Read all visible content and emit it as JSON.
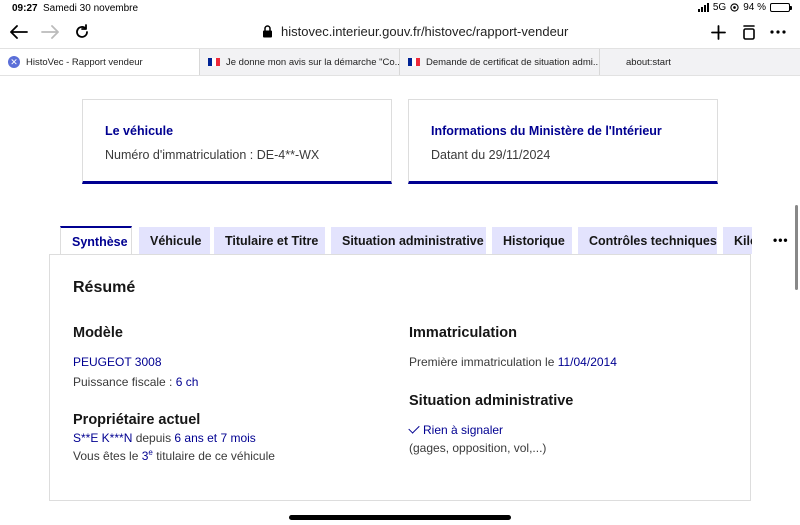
{
  "status": {
    "time": "09:27",
    "date": "Samedi 30 novembre",
    "network": "5G",
    "battery": "94 %"
  },
  "browser": {
    "url": "histovec.interieur.gouv.fr/histovec/rapport-vendeur",
    "tabs": [
      {
        "label": "HistoVec - Rapport vendeur"
      },
      {
        "label": "Je donne mon avis sur la démarche \"Co..."
      },
      {
        "label": "Demande de certificat de situation admi..."
      },
      {
        "label": "about:start"
      }
    ]
  },
  "cards": {
    "vehicule": {
      "title": "Le véhicule",
      "text": "Numéro d'immatriculation : DE-4**-WX"
    },
    "ministere": {
      "title": "Informations du Ministère de l'Intérieur",
      "text": "Datant du 29/11/2024"
    }
  },
  "tabs": {
    "synthese": "Synthèse",
    "vehicule": "Véhicule",
    "titulaire": "Titulaire et Titre",
    "situation": "Situation administrative",
    "historique": "Historique",
    "controles": "Contrôles techniques",
    "kilometrage": "Kilométrage"
  },
  "more_label": "•••",
  "resume": {
    "title": "Résumé",
    "modele": {
      "title": "Modèle",
      "name": "PEUGEOT 3008",
      "puissance_label": "Puissance fiscale : ",
      "puissance_value": "6 ch"
    },
    "proprietaire": {
      "title": "Propriétaire actuel",
      "name": "S**E K***N",
      "depuis": " depuis ",
      "duree": "6 ans et 7 mois",
      "vous_etes": "Vous êtes le ",
      "rang": "3",
      "rang_sup": "e",
      "suite": " titulaire de ce véhicule"
    },
    "immatriculation": {
      "title": "Immatriculation",
      "label": "Première immatriculation le ",
      "date": "11/04/2014"
    },
    "situation": {
      "title": "Situation administrative",
      "status": "Rien à signaler",
      "detail": "(gages, opposition, vol,...)"
    }
  },
  "colors": {
    "accent": "#000091",
    "tab_bg": "#e3e3fd",
    "tab_badge": "#5b6fd8"
  }
}
